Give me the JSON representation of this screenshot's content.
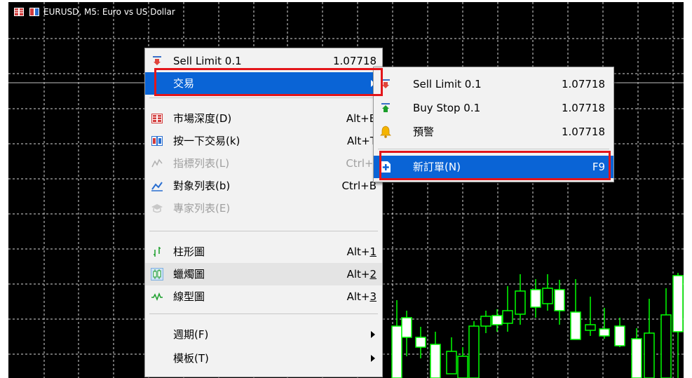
{
  "window": {
    "title": "EURUSD, M5:  Euro vs US Dollar",
    "title_icons": [
      "depth-of-market-icon",
      "one-click-trading-icon"
    ]
  },
  "colors": {
    "chart_bg": "#000000",
    "grid": "#ffffff",
    "bull": "#00ff00",
    "bear": "#ffffff",
    "price_line": "#c0c0c0",
    "menu_highlight": "#0a64d6",
    "callout_border": "#e3161b"
  },
  "context_menu": {
    "sell_limit": {
      "label": "Sell Limit 0.1",
      "price": "1.07718",
      "icon": "sell-limit-icon"
    },
    "trading": {
      "label": "交易",
      "icon": "none"
    },
    "items": [
      {
        "label": "市場深度(D)",
        "shortcut": "Alt+B",
        "icon": "depth-of-market-icon",
        "disabled": false
      },
      {
        "label": "按一下交易(k)",
        "shortcut": "Alt+T",
        "icon": "one-click-trading-icon",
        "disabled": false
      },
      {
        "label": "指標列表(L)",
        "shortcut": "Ctrl+I",
        "icon": "indicators-list-icon",
        "disabled": true
      },
      {
        "label": "對象列表(b)",
        "shortcut": "Ctrl+B",
        "icon": "objects-list-icon",
        "disabled": false
      },
      {
        "label": "專家列表(E)",
        "shortcut": "",
        "icon": "expert-list-icon",
        "disabled": true
      }
    ],
    "chart_types": [
      {
        "label": "柱形圖",
        "shortcut_prefix": "Alt+",
        "shortcut_key": "1",
        "icon": "bar-chart-icon"
      },
      {
        "label": "蠟燭圖",
        "shortcut_prefix": "Alt+",
        "shortcut_key": "2",
        "icon": "candlestick-icon"
      },
      {
        "label": "線型圖",
        "shortcut_prefix": "Alt+",
        "shortcut_key": "3",
        "icon": "line-chart-icon"
      }
    ],
    "period": {
      "label": "週期(F)"
    },
    "template": {
      "label": "模板(T)"
    }
  },
  "submenu": {
    "items": [
      {
        "label": "Sell Limit 0.1",
        "price": "1.07718",
        "icon": "sell-limit-icon"
      },
      {
        "label": "Buy Stop 0.1",
        "price": "1.07718",
        "icon": "buy-stop-icon"
      },
      {
        "label": "預警",
        "price": "1.07718",
        "icon": "alert-bell-icon"
      }
    ],
    "new_order": {
      "label": "新訂單(N)",
      "shortcut": "F9",
      "icon": "new-order-icon"
    }
  }
}
